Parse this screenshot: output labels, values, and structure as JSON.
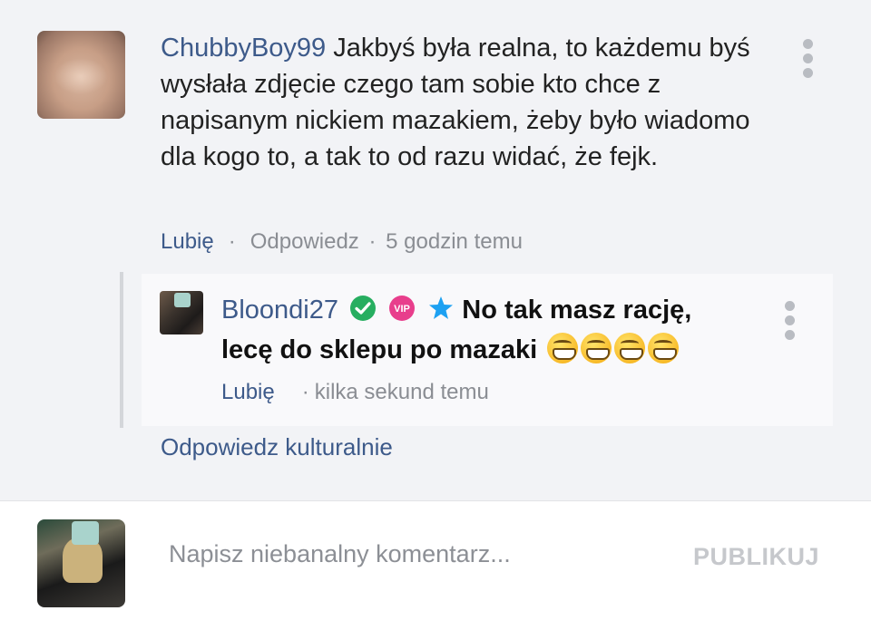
{
  "comment": {
    "author": "ChubbyBoy99",
    "text": "Jakbyś była realna, to każdemu byś wysłała zdjęcie czego tam sobie kto chce z napisanym nickiem mazakiem, żeby było wiadomo dla kogo to, a tak to od razu widać, że fejk.",
    "like_label": "Lubię",
    "separator": "·",
    "reply_label": "Odpowiedz",
    "time_separator": "·",
    "timestamp": "5 godzin temu"
  },
  "reply": {
    "author": "Bloondi27",
    "badges": [
      "verified-check",
      "vip",
      "star"
    ],
    "vip_text": "VIP",
    "text": "No tak masz rację, lecę do sklepu po mazaki",
    "emoji_name": "grinning-face-with-smiling-eyes",
    "emoji_count": 4,
    "like_label": "Lubię",
    "time_separator": "·",
    "timestamp": "kilka sekund temu"
  },
  "reply_link": "Odpowiedz kulturalnie",
  "composer": {
    "placeholder": "Napisz niebanalny komentarz...",
    "publish_label": "PUBLIKUJ"
  },
  "colors": {
    "link": "#3d5a8a",
    "verified": "#27ae60",
    "vip": "#e83e8c",
    "star": "#1da1f2",
    "background": "#f2f3f6"
  }
}
